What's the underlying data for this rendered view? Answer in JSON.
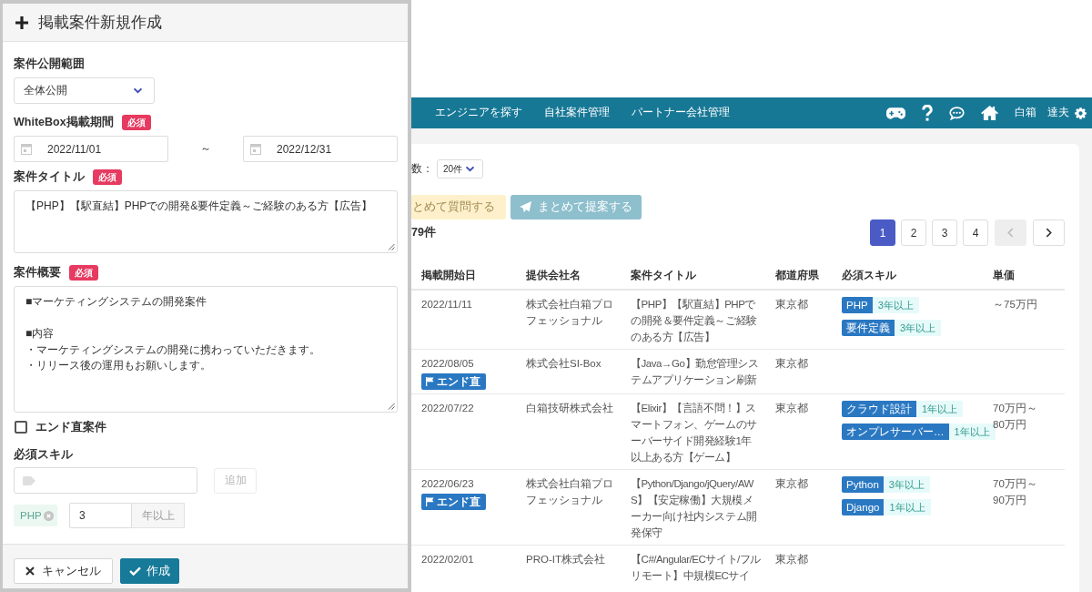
{
  "form_panel": {
    "title": "掲載案件新規作成",
    "visibility": {
      "label": "案件公開範囲",
      "value": "全体公開"
    },
    "period": {
      "label": "WhiteBox掲載期間",
      "badge": "必須",
      "start": "2022/11/01",
      "separator": "～",
      "end": "2022/12/31"
    },
    "job_title": {
      "label": "案件タイトル",
      "badge": "必須",
      "value": "【PHP】【駅直結】PHPでの開発&要件定義～ご経験のある方【広告】"
    },
    "summary": {
      "label": "案件概要",
      "badge": "必須",
      "paragraphs": [
        [
          "■マーケティングシステムの開発案件"
        ],
        [
          "■内容",
          "・マーケティングシステムの開発に携わっていただきます。",
          "・リリース後の運用もお願いします。"
        ]
      ]
    },
    "end_direct": {
      "label": "エンド直案件",
      "checked": false
    },
    "skills": {
      "label": "必須スキル",
      "add_button": {
        "label": "追加",
        "disabled": true
      },
      "items": [
        {
          "name": "PHP",
          "years": "3",
          "unit": "年以上"
        }
      ]
    },
    "footer_buttons": [
      {
        "label": "キャンセル",
        "kind": "cancel"
      },
      {
        "label": "作成",
        "kind": "submit"
      }
    ]
  },
  "nav": {
    "links": [
      "エンジニアを探す",
      "自社案件管理",
      "パートナー会社管理"
    ],
    "user_name": "白箱　達夫"
  },
  "toolbar": {
    "per_page_label": "数：",
    "per_page": "20件",
    "actions": [
      {
        "label": "とめて質問する",
        "kind": "question",
        "disabled": true
      },
      {
        "label": "まとめて提案する",
        "kind": "propose",
        "disabled": true
      }
    ],
    "total": "79件"
  },
  "pagination": {
    "pages": [
      {
        "label": "1",
        "selected": true
      },
      {
        "label": "2",
        "selected": false
      },
      {
        "label": "3",
        "selected": false
      },
      {
        "label": "4",
        "selected": false
      }
    ],
    "previous": {
      "disabled": true
    },
    "next": {
      "disabled": false
    }
  },
  "table": {
    "columns": [
      "掲載開始日",
      "提供会社名",
      "案件タイトル",
      "都道府県",
      "必須スキル",
      "単価"
    ],
    "rows": [
      {
        "date": "2022/11/11",
        "company": "株式会社白箱プロフェッショナル",
        "title": "【PHP】【駅直結】PHPでの開発＆要件定義～ご経験のある方【広告】",
        "prefecture": "東京都",
        "skills": [
          {
            "name": "PHP",
            "years": "3年以上"
          },
          {
            "name": "要件定義",
            "years": "3年以上"
          }
        ],
        "price": "～75万円"
      },
      {
        "date": "2022/08/05",
        "badge": "エンド直",
        "company": "株式会社SI-Box",
        "title": "【Java→Go】勤怠管理システムアプリケーション刷新",
        "prefecture": "東京都"
      },
      {
        "date": "2022/07/22",
        "company": "白箱技研株式会社",
        "title": "【Elixir】【言語不問！】スマートフォン、ゲームのサーバーサイド開発経験1年以上ある方【ゲーム】",
        "prefecture": "東京都",
        "skills": [
          {
            "name": "クラウド設計",
            "years": "1年以上"
          },
          {
            "name": "オンプレサーバー…",
            "years": "1年以上"
          }
        ],
        "price": "70万円～80万円"
      },
      {
        "date": "2022/06/23",
        "badge": "エンド直",
        "company": "株式会社白箱プロフェッショナル",
        "title": "【Python/Django/jQuery/AWS】【安定稼働】大規模メーカー向け社内システム開発保守",
        "prefecture": "東京都",
        "skills": [
          {
            "name": "Python",
            "years": "3年以上"
          },
          {
            "name": "Django",
            "years": "1年以上"
          }
        ],
        "price": "70万円～90万円"
      },
      {
        "date": "2022/02/01",
        "company": "PRO-IT株式会社",
        "title": "【C#/Angular/ECサイト/フルリモート】中規模ECサイ",
        "prefecture": "東京都"
      }
    ]
  }
}
